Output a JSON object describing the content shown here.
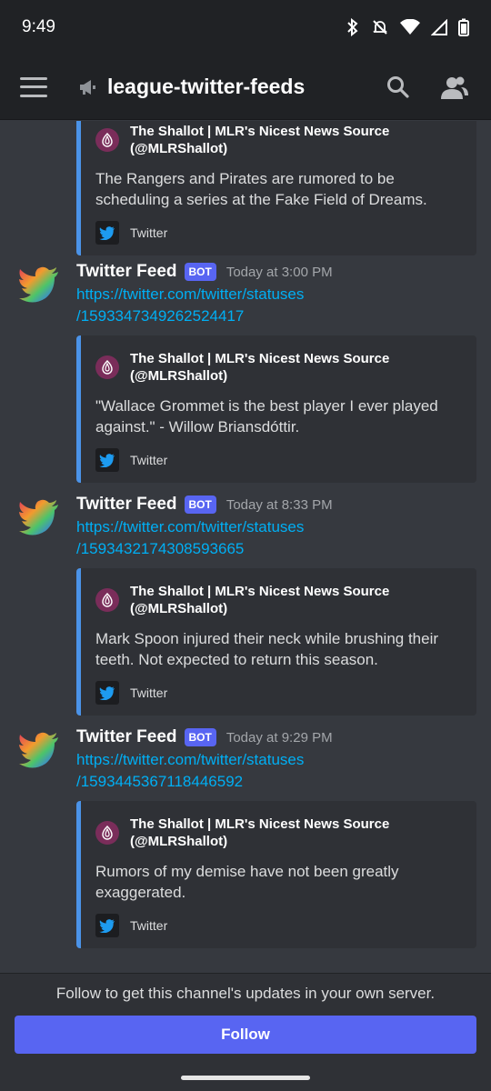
{
  "status_bar": {
    "time": "9:49"
  },
  "header": {
    "channel_name": "league-twitter-feeds"
  },
  "messages": [
    {
      "embed": {
        "author": "The Shallot | MLR's Nicest News Source (@MLRShallot)",
        "description": "The Rangers and Pirates are rumored to be scheduling a series at the Fake Field of Dreams.",
        "footer": "Twitter"
      }
    },
    {
      "author": "Twitter Feed",
      "badge": "BOT",
      "timestamp": "Today at 3:00 PM",
      "link_line1": "https://twitter.com/twitter/statuses",
      "link_line2": "/1593347349262524417",
      "embed": {
        "author": "The Shallot | MLR's Nicest News Source (@MLRShallot)",
        "description": "\"Wallace Grommet is the best player I ever played against.\" - Willow Briansdóttir.",
        "footer": "Twitter"
      }
    },
    {
      "author": "Twitter Feed",
      "badge": "BOT",
      "timestamp": "Today at 8:33 PM",
      "link_line1": "https://twitter.com/twitter/statuses",
      "link_line2": "/1593432174308593665",
      "embed": {
        "author": "The Shallot | MLR's Nicest News Source (@MLRShallot)",
        "description": "Mark Spoon injured their neck while brushing their teeth. Not expected to return this season.",
        "footer": "Twitter"
      }
    },
    {
      "author": "Twitter Feed",
      "badge": "BOT",
      "timestamp": "Today at 9:29 PM",
      "link_line1": "https://twitter.com/twitter/statuses",
      "link_line2": "/1593445367118446592",
      "embed": {
        "author": "The Shallot | MLR's Nicest News Source (@MLRShallot)",
        "description": "Rumors of my demise have not been greatly exaggerated.",
        "footer": "Twitter"
      }
    }
  ],
  "follow_bar": {
    "prompt": "Follow to get this channel's updates in your own server.",
    "button_label": "Follow"
  },
  "colors": {
    "accent": "#5865f2",
    "link": "#00aff4",
    "embed_border": "#4b93e8",
    "background": "#36393f"
  },
  "icons": [
    "hamburger-menu-icon",
    "announcement-channel-icon",
    "search-icon",
    "members-icon",
    "bird-avatar-icon",
    "onion-avatar-icon",
    "twitter-icon",
    "bluetooth-icon",
    "mute-icon",
    "wifi-icon",
    "signal-icon",
    "battery-icon"
  ]
}
